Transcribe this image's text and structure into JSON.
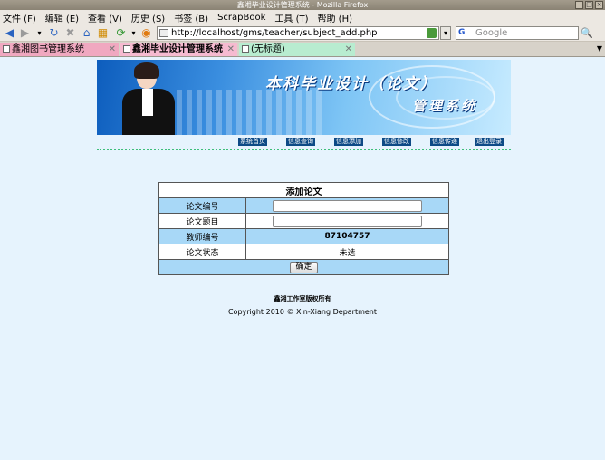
{
  "window": {
    "title": "鑫湘毕业设计管理系统 - Mozilla Firefox"
  },
  "menu": [
    "文件 (F)",
    "编辑 (E)",
    "查看 (V)",
    "历史 (S)",
    "书签 (B)",
    "ScrapBook",
    "工具 (T)",
    "帮助 (H)"
  ],
  "nav": {
    "url": "http://localhost/gms/teacher/subject_add.php",
    "search_placeholder": "Google",
    "search_engine_letter": "G"
  },
  "tabs": [
    {
      "label": "鑫湘图书管理系统"
    },
    {
      "label": "鑫湘毕业设计管理系统"
    },
    {
      "label": "(无标题)"
    }
  ],
  "banner": {
    "title_line1": "本科毕业设计（论文）",
    "title_line2": "管理系统"
  },
  "site_nav": [
    "系统首页",
    "信息查询",
    "信息添加",
    "信息修改",
    "信息传递",
    "退出登录"
  ],
  "form": {
    "caption": "添加论文",
    "rows": [
      {
        "label": "论文编号",
        "value": ""
      },
      {
        "label": "论文题目",
        "value": ""
      },
      {
        "label": "教师编号",
        "value": "87104757"
      },
      {
        "label": "论文状态",
        "value": "未选"
      }
    ],
    "submit_label": "确定"
  },
  "footer": {
    "line1": "鑫湘工作室版权所有",
    "line2": "Copyright 2010 © Xin-Xiang Department"
  },
  "colors": {
    "page_bg": "#e6f3fd",
    "row_blue": "#a8d8f7",
    "nav_link_bg": "#0d4a86"
  }
}
